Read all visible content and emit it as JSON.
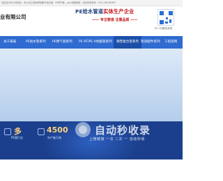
{
  "topbar": {
    "notice": "欢迎访问本公司网站，本公司主营各种规格PE给水管、PE燃气管、pert地暖管道，欢迎来电咨询：0311-86789987"
  },
  "header": {
    "company_name": "业有限公司",
    "slogan_prefix": "PE给水管道",
    "slogan_highlight": "实体生产企业",
    "slogan2_a": "—— 专注管道",
    "slogan2_b": "注重品质 ——",
    "qr_caption": "扫一扫微信咨询"
  },
  "nav": {
    "items": [
      {
        "label": "关于豪泰",
        "active": false
      },
      {
        "label": "PE给水管系列",
        "active": false
      },
      {
        "label": "PE燃气管系列",
        "active": false
      },
      {
        "label": "PE-RT/PE-X地暖管系列",
        "active": false
      },
      {
        "label": "钢塑复合管系列",
        "active": true
      },
      {
        "label": "管道配件系列",
        "active": false
      },
      {
        "label": "工程案例",
        "active": false
      }
    ]
  },
  "stats": [
    {
      "number": "多",
      "label": "PE管行业"
    },
    {
      "number": "4500",
      "label": "年产能万吨"
    }
  ],
  "watermark": {
    "title": "自动秒收录",
    "subtitle": "上榜链接 一次 二次 一 自动秒收"
  },
  "colors": {
    "nav": "#2f6bd0",
    "band": "#1b3f8c",
    "accent_red": "#c4161c",
    "accent_blue": "#1a3f7a"
  }
}
